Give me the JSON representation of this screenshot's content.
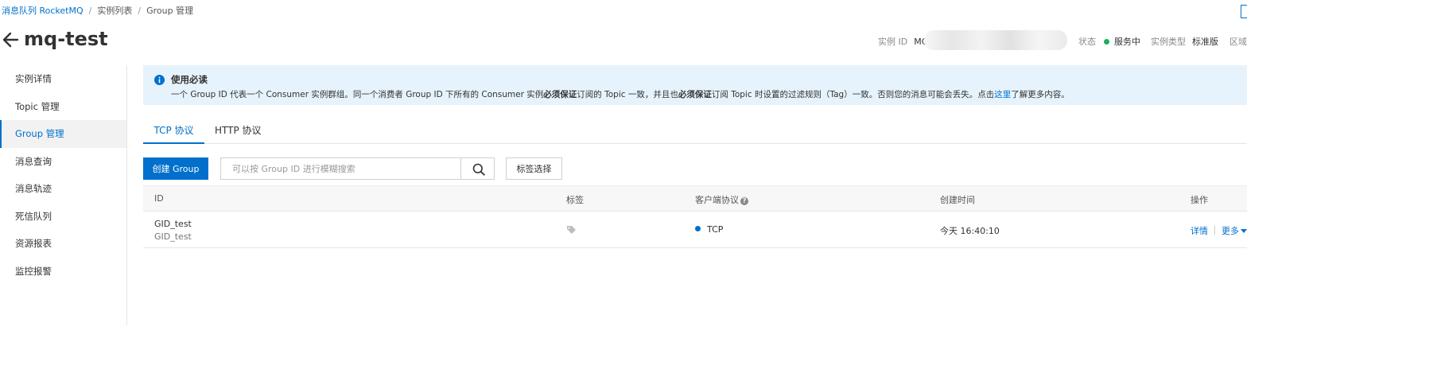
{
  "breadcrumb": {
    "items": [
      "消息队列 RocketMQ",
      "实例列表",
      "Group 管理"
    ],
    "separator": "/"
  },
  "page": {
    "title": "mq-test"
  },
  "meta": {
    "instance_id_label": "实例 ID",
    "instance_id_value": "MC",
    "status_label": "状态",
    "status_value": "服务中",
    "status_color": "#1aae5c",
    "type_label": "实例类型",
    "type_value": "标准版",
    "region_label": "区域"
  },
  "sidebar": {
    "items": [
      {
        "label": "实例详情",
        "active": false
      },
      {
        "label": "Topic 管理",
        "active": false
      },
      {
        "label": "Group 管理",
        "active": true
      },
      {
        "label": "消息查询",
        "active": false
      },
      {
        "label": "消息轨迹",
        "active": false
      },
      {
        "label": "死信队列",
        "active": false
      },
      {
        "label": "资源报表",
        "active": false
      },
      {
        "label": "监控报警",
        "active": false
      }
    ]
  },
  "notice": {
    "title": "使用必读",
    "text_1": "一个 Group ID 代表一个 Consumer 实例群组。同一个消费者 Group ID 下所有的 Consumer 实例",
    "bold_1": "必须保证",
    "text_2": "订阅的 Topic 一致，并且也",
    "bold_2": "必须保证",
    "text_3": "订阅 Topic 时设置的过滤规则（Tag）一致。否则您的消息可能会丢失。点击",
    "link": "这里",
    "text_4": "了解更多内容。"
  },
  "tabs": [
    {
      "label": "TCP 协议",
      "active": true
    },
    {
      "label": "HTTP 协议",
      "active": false
    }
  ],
  "toolbar": {
    "create_label": "创建 Group",
    "search_placeholder": "可以按 Group ID 进行模糊搜索",
    "search_value": "",
    "tag_filter_label": "标签选择"
  },
  "table": {
    "headers": {
      "id": "ID",
      "tag": "标签",
      "protocol": "客户端协议",
      "created": "创建时间",
      "actions": "操作"
    },
    "rows": [
      {
        "id": "GID_test",
        "id_sub": "GID_test",
        "protocol": "TCP",
        "created": "今天 16:40:10",
        "action_detail": "详情",
        "action_more": "更多"
      }
    ]
  },
  "colors": {
    "primary": "#0070cc",
    "notice_bg": "#e6f3fc",
    "status_dot": "#1aae5c"
  }
}
